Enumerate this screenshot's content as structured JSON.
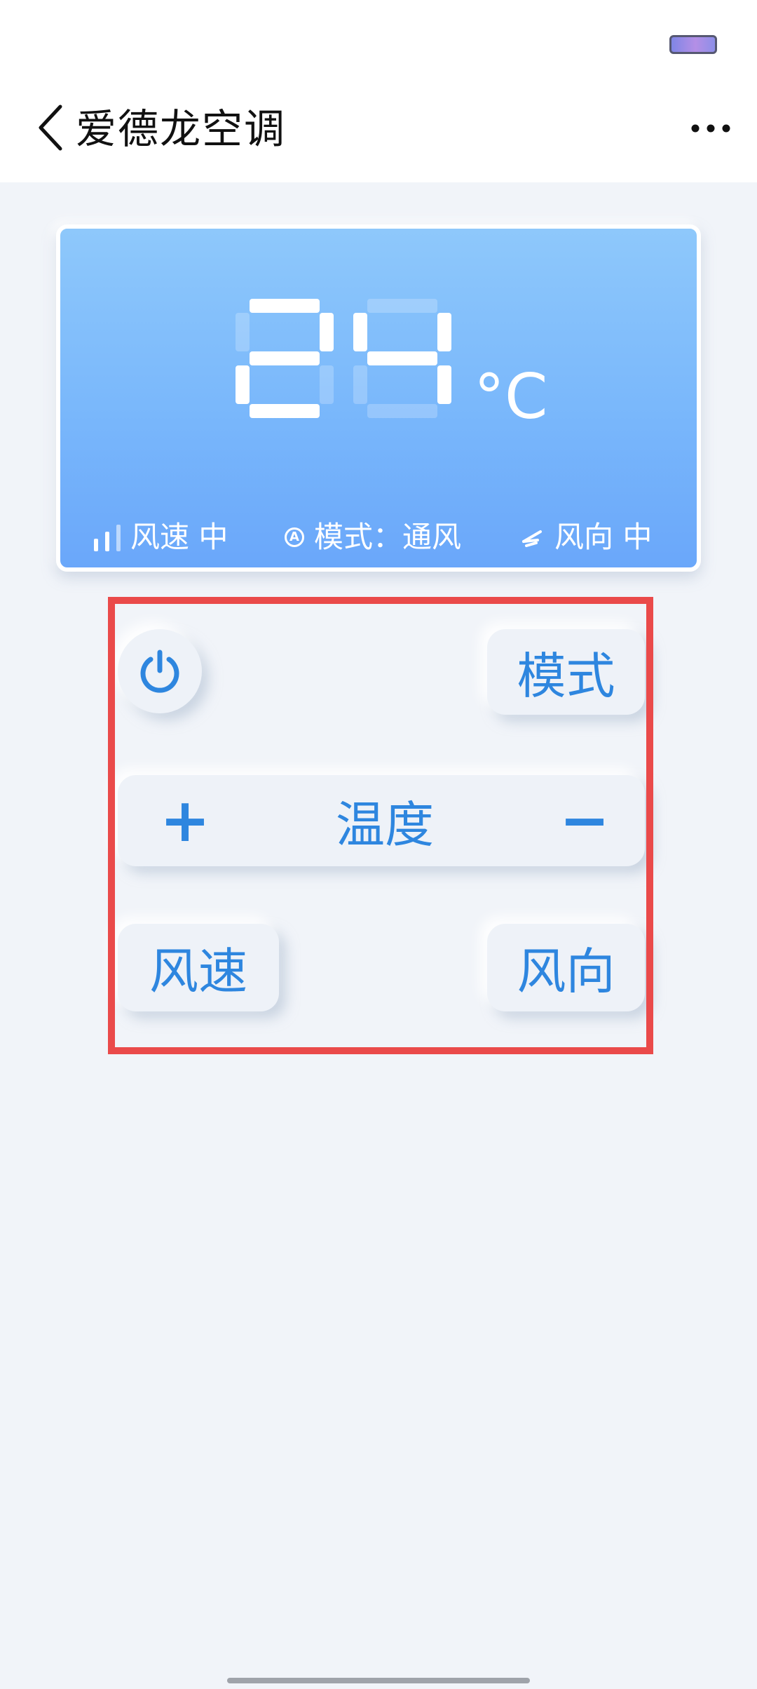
{
  "header": {
    "title": "爱德龙空调",
    "back_icon": "chevron-left-icon",
    "more_icon": "more-horizontal-icon"
  },
  "display": {
    "temperature": 24,
    "unit": "°C",
    "fan_speed": "风速 中",
    "mode": "模式：通风",
    "swing": "风向 中"
  },
  "controls": {
    "power_icon": "power-icon",
    "mode_label": "模式",
    "temp_plus": "+",
    "temp_label": "温度",
    "temp_minus": "−",
    "speed_label": "风速",
    "direction_label": "风向"
  },
  "colors": {
    "accent": "#2e86df",
    "card_gradient_top": "#8ec8fb",
    "card_gradient_bottom": "#6aa7fa",
    "highlight": "#ea4a4a",
    "background": "#f1f4f9"
  }
}
